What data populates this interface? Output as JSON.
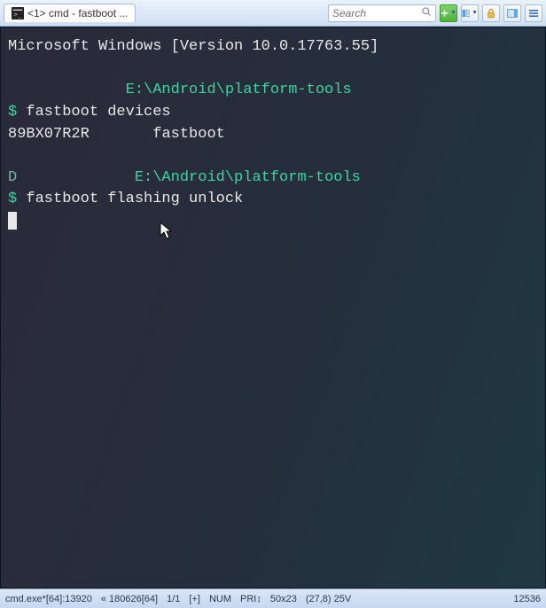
{
  "tab": {
    "title": "<1> cmd - fastboot ..."
  },
  "toolbar": {
    "search_placeholder": "Search"
  },
  "terminal": {
    "header": "Microsoft Windows [Version 10.0.17763.55]",
    "path": "E:\\Android\\platform-tools",
    "prompt_symbol": "$",
    "cmd1": "fastboot devices",
    "out1_device": "89BX07R2R",
    "out1_state": "fastboot",
    "prompt2_prefix": "D          ",
    "cmd2": "fastboot flashing unlock"
  },
  "statusbar": {
    "proc": "cmd.exe*[64]:13920",
    "build": "« 180626[64]",
    "pages": "1/1",
    "ins": "[+]",
    "num": "NUM",
    "pri": "PRI↕",
    "size": "50x23",
    "pos": "(27,8) 25V",
    "pid": "12536"
  }
}
